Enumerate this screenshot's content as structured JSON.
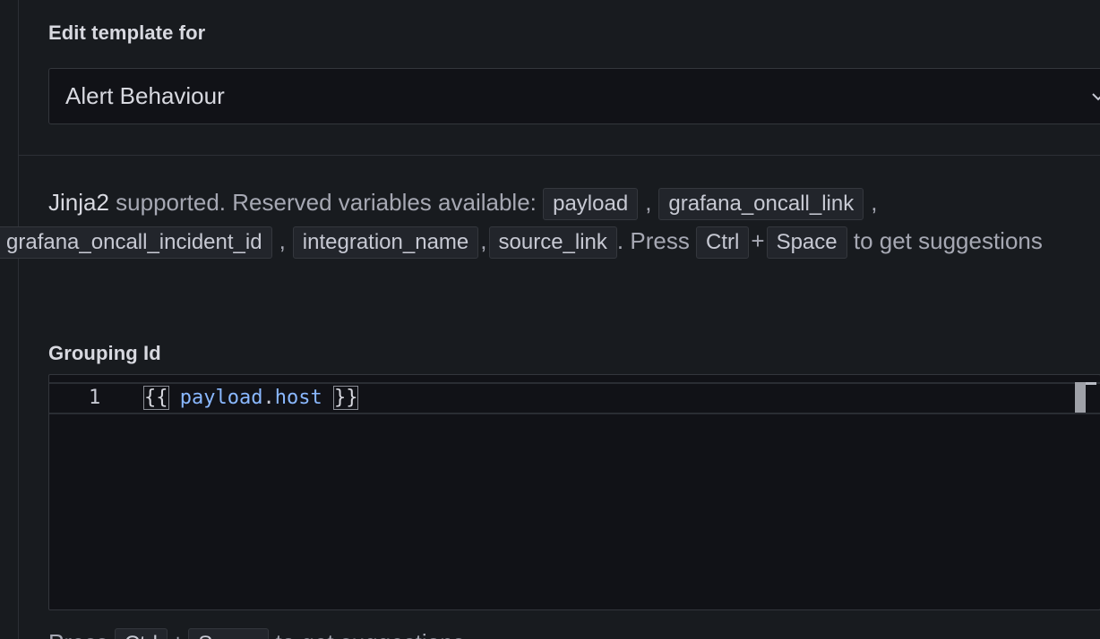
{
  "template_section": {
    "label": "Edit template for",
    "selected": "Alert Behaviour"
  },
  "help": {
    "strong": "Jinja2",
    "text1": " supported. Reserved variables available: ",
    "chips": [
      "payload",
      "grafana_oncall_link",
      "grafana_oncall_incident_id",
      "integration_name",
      "source_link"
    ],
    "sep": ",",
    "press": ". Press ",
    "ctrl": "Ctrl",
    "plus": "+",
    "space": "Space",
    "tail": " to get suggestions"
  },
  "grouping": {
    "label": "Grouping Id",
    "line_number": "1",
    "open_brace": "{{",
    "var_obj": "payload",
    "dot": ".",
    "var_prop": "host",
    "close_brace": "}}"
  },
  "footer": {
    "press": "Press ",
    "ctrl": "Ctrl",
    "plus": "+",
    "space": "Space",
    "tail": " to get suggestions"
  }
}
